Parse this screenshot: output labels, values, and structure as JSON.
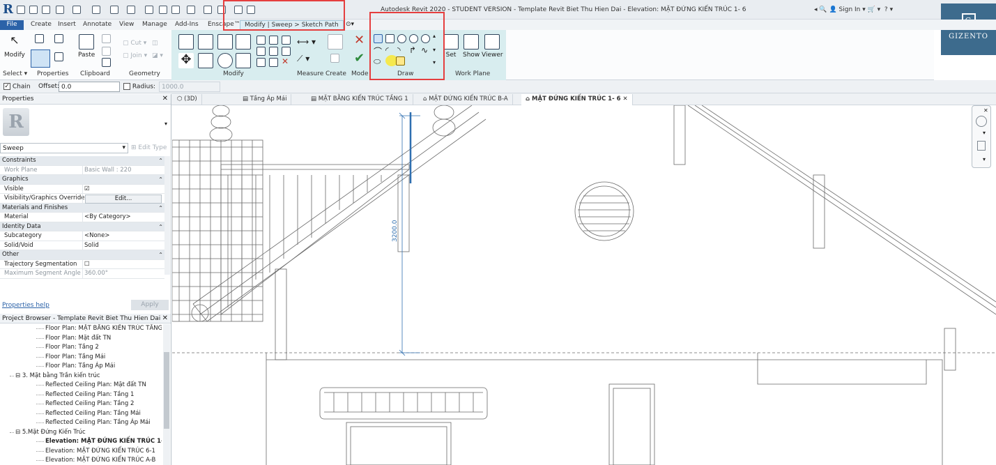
{
  "titlebar": {
    "title": "Autodesk Revit 2020 - STUDENT VERSION - Template Revit Biet Thu Hien Dai - Elevation: MẶT ĐỨNG KIẾN TRÚC 1- 6",
    "sign_in": "Sign In",
    "help": "?"
  },
  "brand": {
    "name": "GIZENTO",
    "initial": "G"
  },
  "tabs": [
    "File",
    "Create",
    "Insert",
    "Annotate",
    "View",
    "Manage",
    "Add-Ins",
    "Enscape™",
    "Modify | Sweep > Sketch Path"
  ],
  "ribbon": {
    "modify": "Modify",
    "select": "Select ▾",
    "properties": "Properties",
    "paste": "Paste",
    "clipboard": "Clipboard",
    "cut": "Cut",
    "join": "Join",
    "geometry": "Geometry",
    "modify_panel": "Modify",
    "measure": "Measure",
    "create": "Create",
    "mode": "Mode",
    "draw": "Draw",
    "set": "Set",
    "show": "Show",
    "viewer": "Viewer",
    "work_plane": "Work Plane"
  },
  "options": {
    "chain": "Chain",
    "offset_label": "Offset:",
    "offset_value": "0.0",
    "radius_label": "Radius:",
    "radius_value": "1000.0"
  },
  "properties": {
    "title": "Properties",
    "type": "Sweep",
    "edit_type": "Edit Type",
    "help_link": "Properties help",
    "apply": "Apply",
    "rows": [
      {
        "k": "Constraints",
        "v": "",
        "cat": true
      },
      {
        "k": "Work Plane",
        "v": "Basic Wall : 220",
        "dim": true
      },
      {
        "k": "Graphics",
        "v": "",
        "cat": true
      },
      {
        "k": "Visible",
        "v": "☑"
      },
      {
        "k": "Visibility/Graphics Overrides",
        "v": "Edit..."
      },
      {
        "k": "Materials and Finishes",
        "v": "",
        "cat": true
      },
      {
        "k": "Material",
        "v": "<By Category>"
      },
      {
        "k": "Identity Data",
        "v": "",
        "cat": true
      },
      {
        "k": "Subcategory",
        "v": "<None>"
      },
      {
        "k": "Solid/Void",
        "v": "Solid"
      },
      {
        "k": "Other",
        "v": "",
        "cat": true
      },
      {
        "k": "Trajectory Segmentation",
        "v": "☐"
      },
      {
        "k": "Maximum Segment Angle",
        "v": "360.00°",
        "dim": true
      }
    ]
  },
  "browser": {
    "title": "Project Browser - Template Revit Biet Thu Hien Dai",
    "items": [
      {
        "label": "Floor Plan: MẶT BẰNG KIẾN TRÚC TẦNG 1",
        "indent": 2
      },
      {
        "label": "Floor Plan: Mặt đất TN",
        "indent": 2
      },
      {
        "label": "Floor Plan: Tầng 2",
        "indent": 2
      },
      {
        "label": "Floor Plan: Tầng Mái",
        "indent": 2
      },
      {
        "label": "Floor Plan: Tầng Áp Mái",
        "indent": 2
      },
      {
        "label": "⊟ 3. Mặt bằng Trần kiến trúc",
        "indent": 1
      },
      {
        "label": "Reflected Ceiling Plan: Mặt đất TN",
        "indent": 2
      },
      {
        "label": "Reflected Ceiling Plan: Tầng 1",
        "indent": 2
      },
      {
        "label": "Reflected Ceiling Plan: Tầng 2",
        "indent": 2
      },
      {
        "label": "Reflected Ceiling Plan: Tầng Mái",
        "indent": 2
      },
      {
        "label": "Reflected Ceiling Plan: Tầng Áp Mái",
        "indent": 2
      },
      {
        "label": "⊟ 5.Mặt Đứng Kiến Trúc",
        "indent": 1
      },
      {
        "label": "Elevation: MẶT ĐỨNG KIẾN TRÚC 1- 6",
        "indent": 2,
        "bold": true
      },
      {
        "label": "Elevation: MẶT ĐỨNG KIẾN TRÚC 6-1",
        "indent": 2
      },
      {
        "label": "Elevation: MẶT ĐỨNG KIẾN TRÚC A-B",
        "indent": 2
      }
    ]
  },
  "view_tabs": [
    "(3D)",
    "Tầng Áp Mái",
    "MẶT BẰNG KIẾN TRÚC TẦNG 1",
    "MẶT ĐỨNG KIẾN TRÚC B-A",
    "MẶT ĐỨNG KIẾN TRÚC 1- 6"
  ],
  "canvas": {
    "dimension_label": "3200.0"
  },
  "colors": {
    "accent": "#2b62a8",
    "context_tab": "#d8edef",
    "highlight": "#e53e3e",
    "sketch": "#2f6fb0"
  }
}
